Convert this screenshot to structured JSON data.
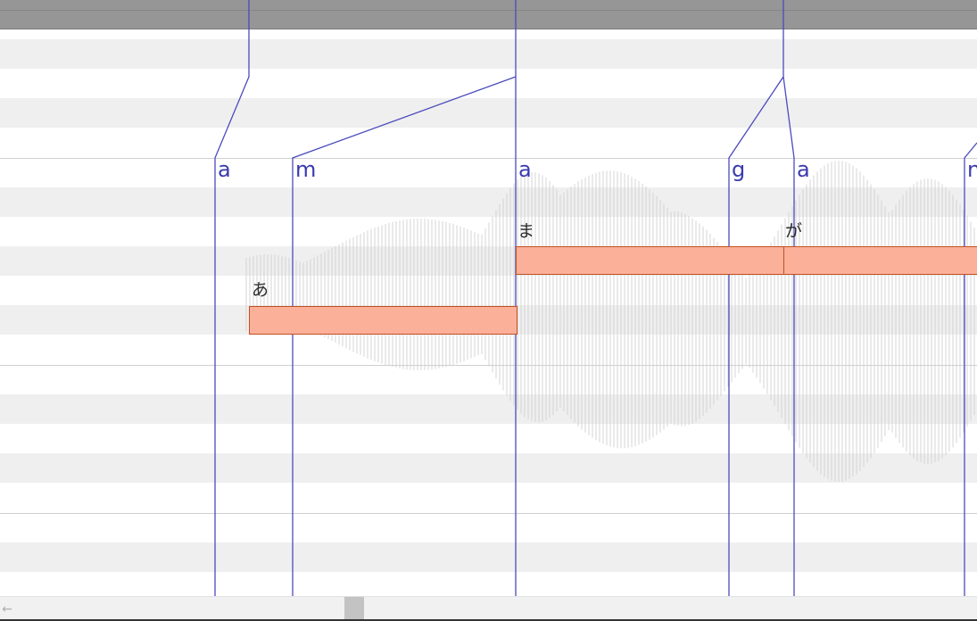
{
  "editor": {
    "phonemes": [
      {
        "symbol": "a"
      },
      {
        "symbol": "m"
      },
      {
        "symbol": "a"
      },
      {
        "symbol": "g"
      },
      {
        "symbol": "a"
      },
      {
        "symbol": "n"
      }
    ],
    "notes": [
      {
        "lyric": "あ"
      },
      {
        "lyric": "ま"
      },
      {
        "lyric": "が"
      }
    ]
  },
  "scrollbar": {
    "left_arrow": "←",
    "thumb_position": 0.36
  },
  "colors": {
    "note_fill": "#fbb09a",
    "note_border": "#c0501f",
    "phoneme_line": "#4b4bbf",
    "phoneme_text": "#3a3ab0",
    "ruler": "#969696",
    "grid_dark_row": "#efefef"
  }
}
